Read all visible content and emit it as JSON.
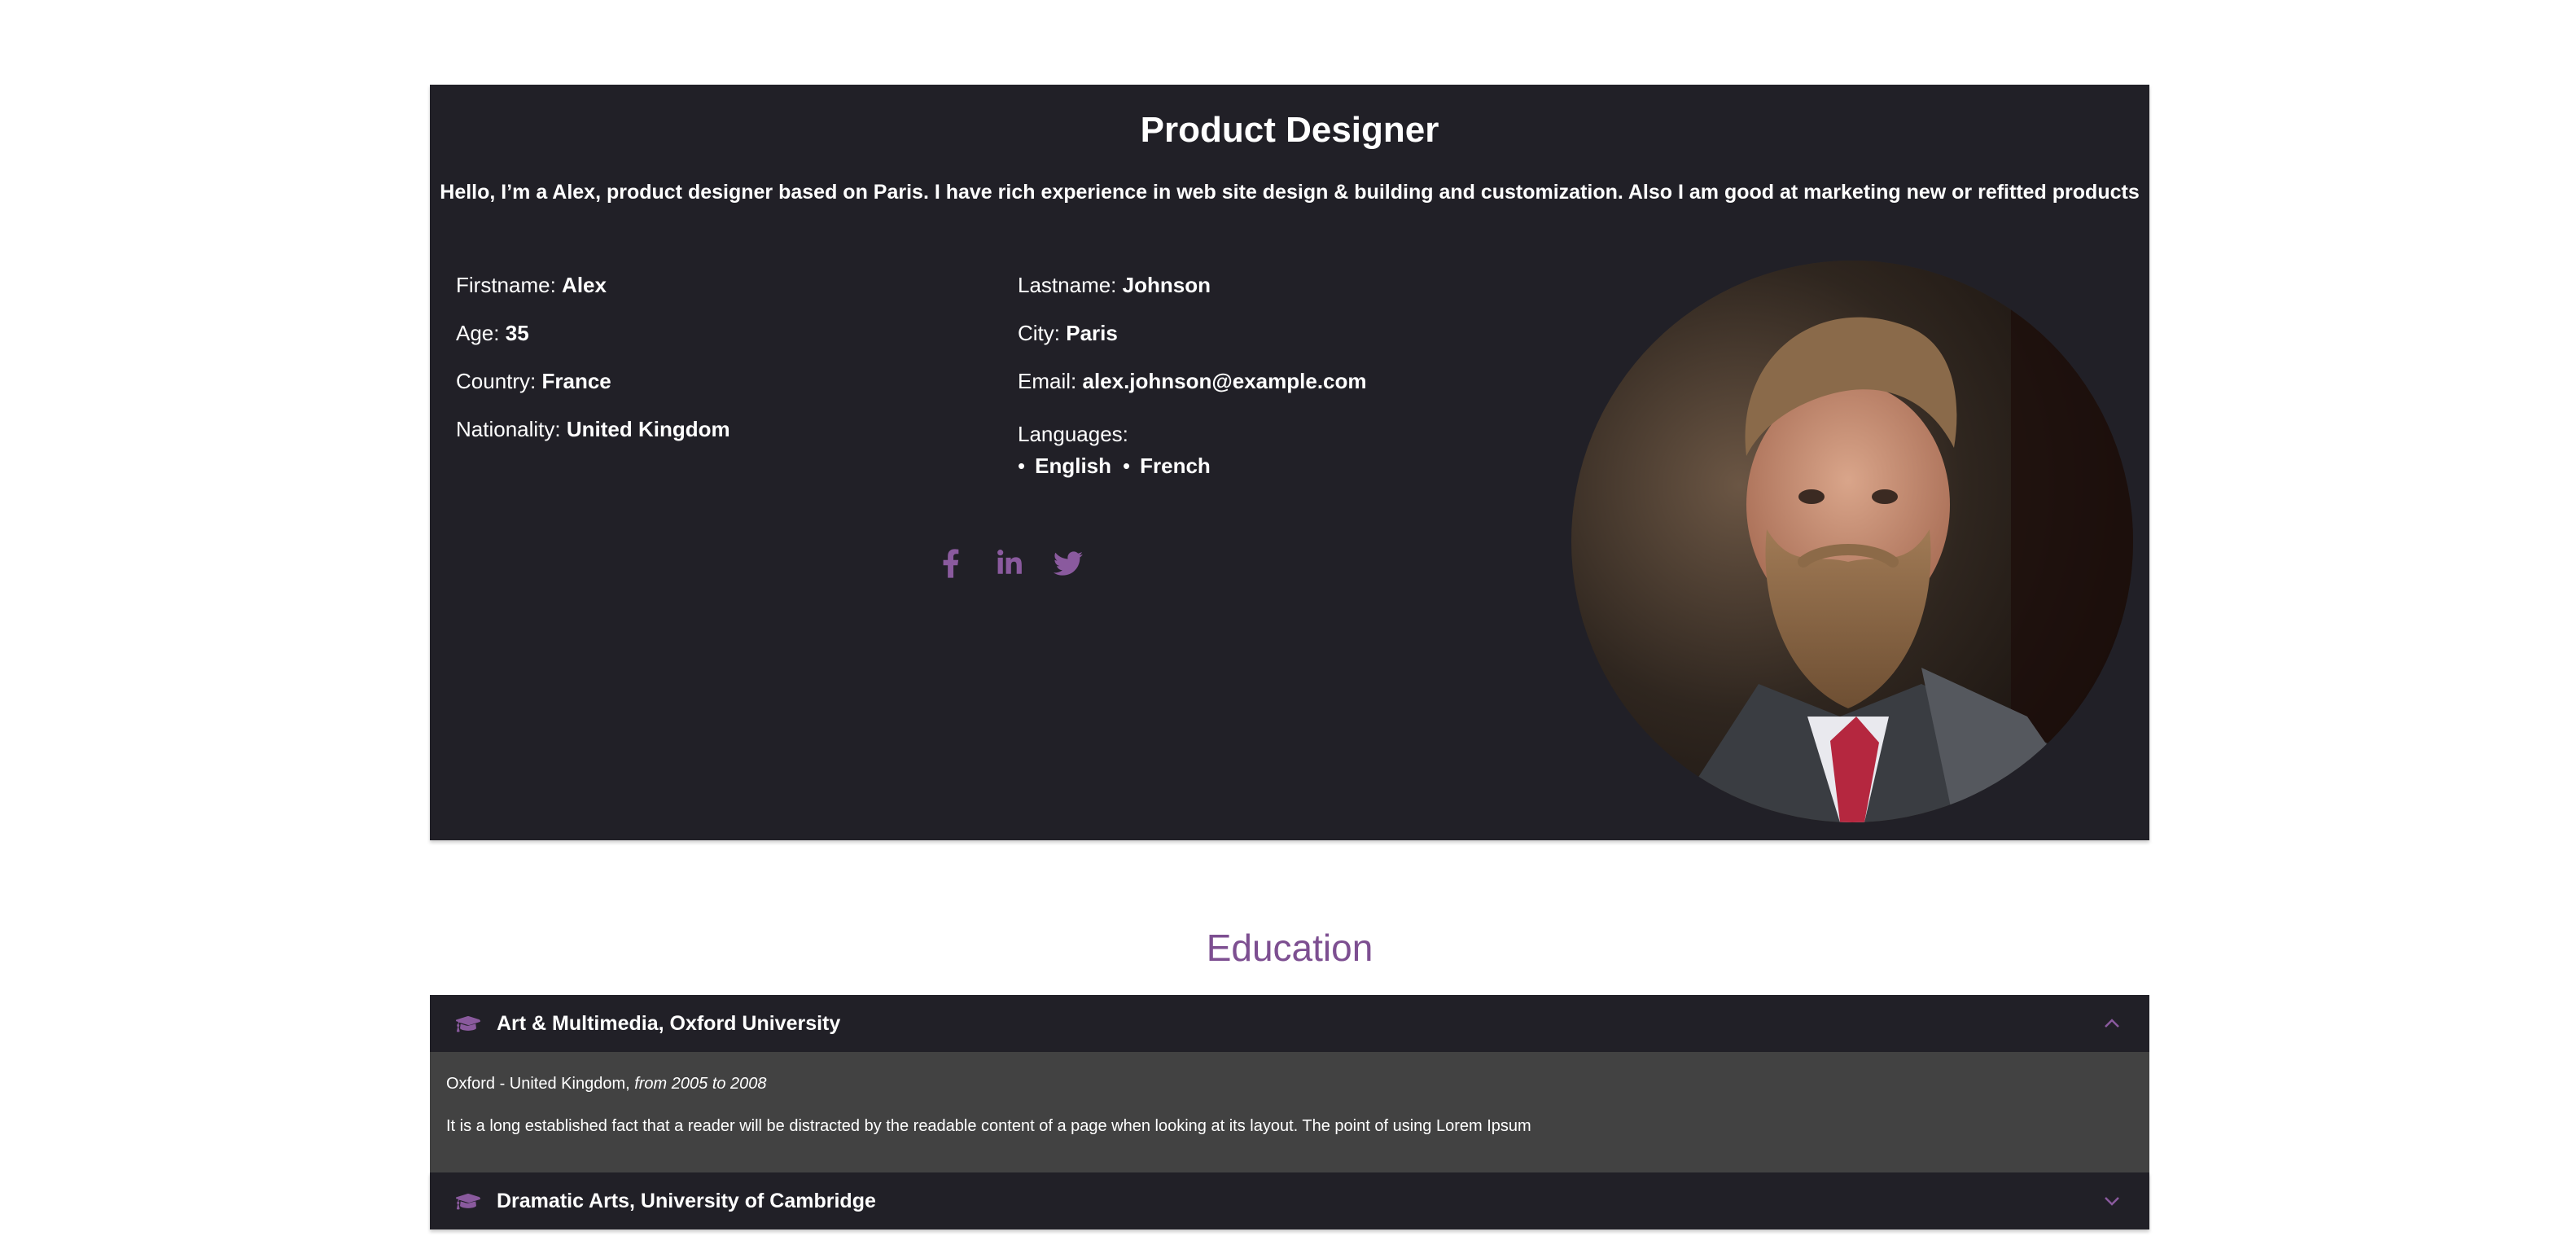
{
  "hero": {
    "title": "Product Designer",
    "intro": "Hello, I’m a Alex, product designer based on Paris. I have rich experience in web site design & building and customization. Also I am good at marketing new or refitted products"
  },
  "profile": {
    "firstname_label": "Firstname:",
    "firstname": "Alex",
    "age_label": "Age:",
    "age": "35",
    "country_label": "Country:",
    "country": "France",
    "nationality_label": "Nationality:",
    "nationality": "United Kingdom",
    "lastname_label": "Lastname:",
    "lastname": "Johnson",
    "city_label": "City:",
    "city": "Paris",
    "email_label": "Email:",
    "email": "alex.johnson@example.com",
    "languages_label": "Languages:",
    "languages": [
      "English",
      "French"
    ]
  },
  "social": {
    "icons": [
      "facebook-icon",
      "linkedin-icon",
      "twitter-icon"
    ],
    "color": "#8a5a9e"
  },
  "education": {
    "title": "Education",
    "items": [
      {
        "title": "Art & Multimedia, Oxford University",
        "location": "Oxford - United Kingdom,",
        "period": "from 2005 to 2008",
        "description": "It is a long established fact that a reader will be distracted by the readable content of a page when looking at its layout. The point of using Lorem Ipsum",
        "expanded": true
      },
      {
        "title": "Dramatic Arts, University of Cambridge",
        "expanded": false
      }
    ]
  },
  "colors": {
    "panel": "#212027",
    "accent": "#7d4f91",
    "body": "#424242"
  }
}
